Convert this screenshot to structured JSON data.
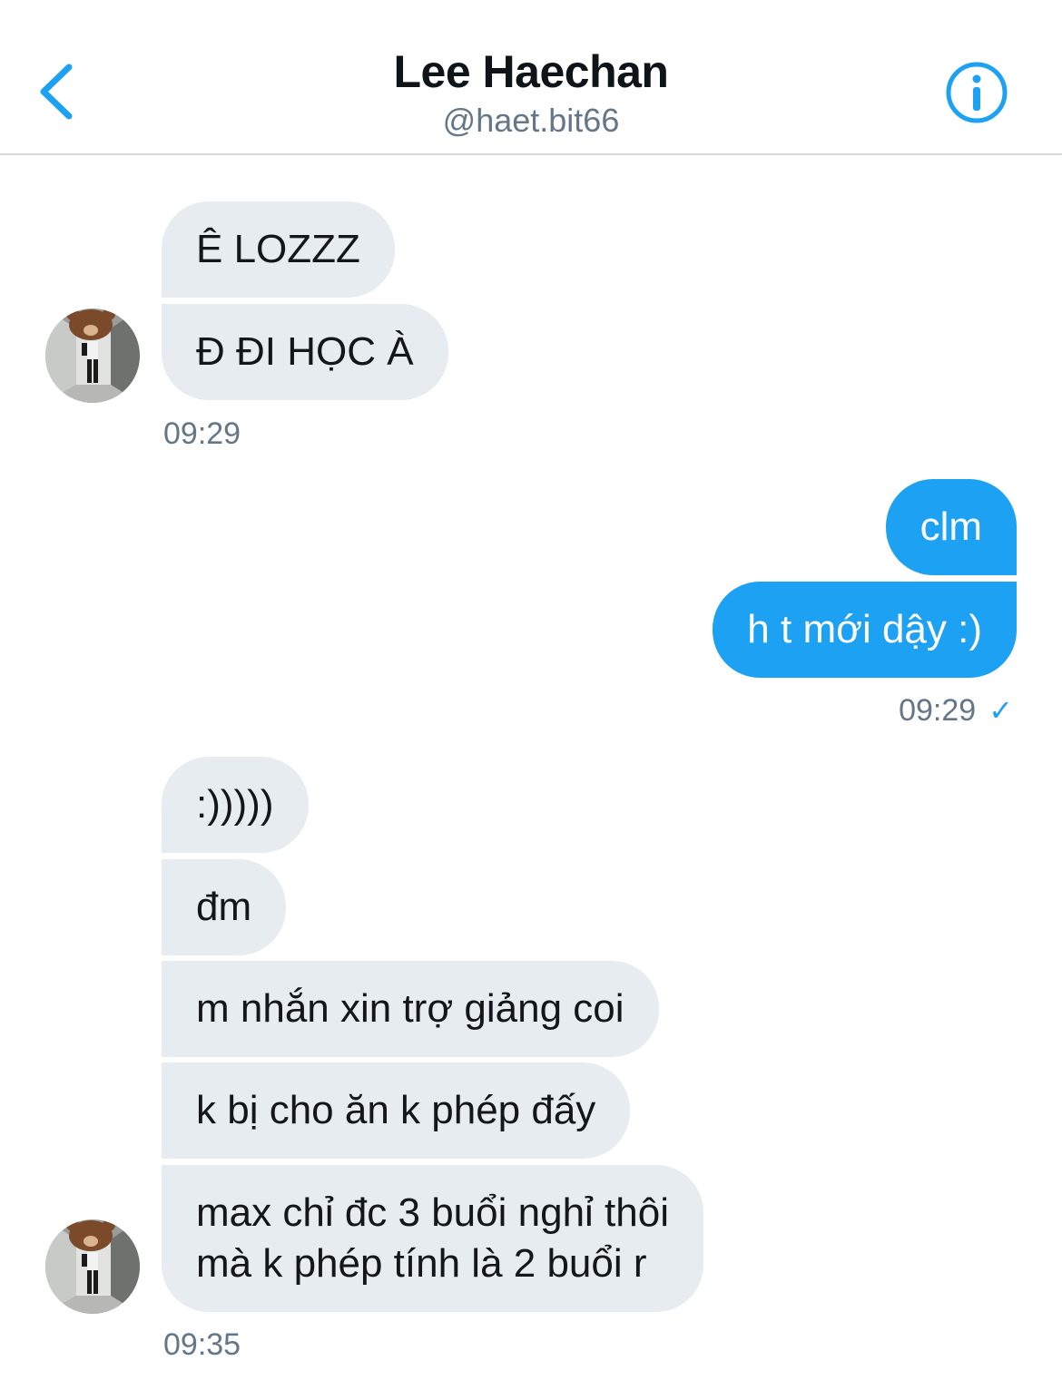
{
  "header": {
    "title": "Lee Haechan",
    "handle": "@haet.bit66",
    "back_icon": "chevron-left-icon",
    "info_icon": "info-icon",
    "accent_color": "#1da1f2"
  },
  "messages": {
    "group1": {
      "m1": "Ê LOZZZ",
      "m2": "Đ ĐI HỌC À",
      "time": "09:29"
    },
    "group2": {
      "m1": "clm",
      "m2": "h t mới dậy :)",
      "time": "09:29",
      "status_icon": "checkmark-icon",
      "status": "✓"
    },
    "group3": {
      "m1": ":)))))",
      "m2": "đm",
      "m3": "m nhắn xin trợ giảng coi",
      "m4": "k bị cho ăn k phép đấy",
      "m5_line1": "max chỉ đc 3 buổi nghỉ thôi",
      "m5_line2": "mà k phép tính là 2 buổi r",
      "time": "09:35"
    }
  },
  "colors": {
    "incoming_bubble": "#e6ecf0",
    "outgoing_bubble": "#1da1f2",
    "timestamp": "#657786"
  }
}
